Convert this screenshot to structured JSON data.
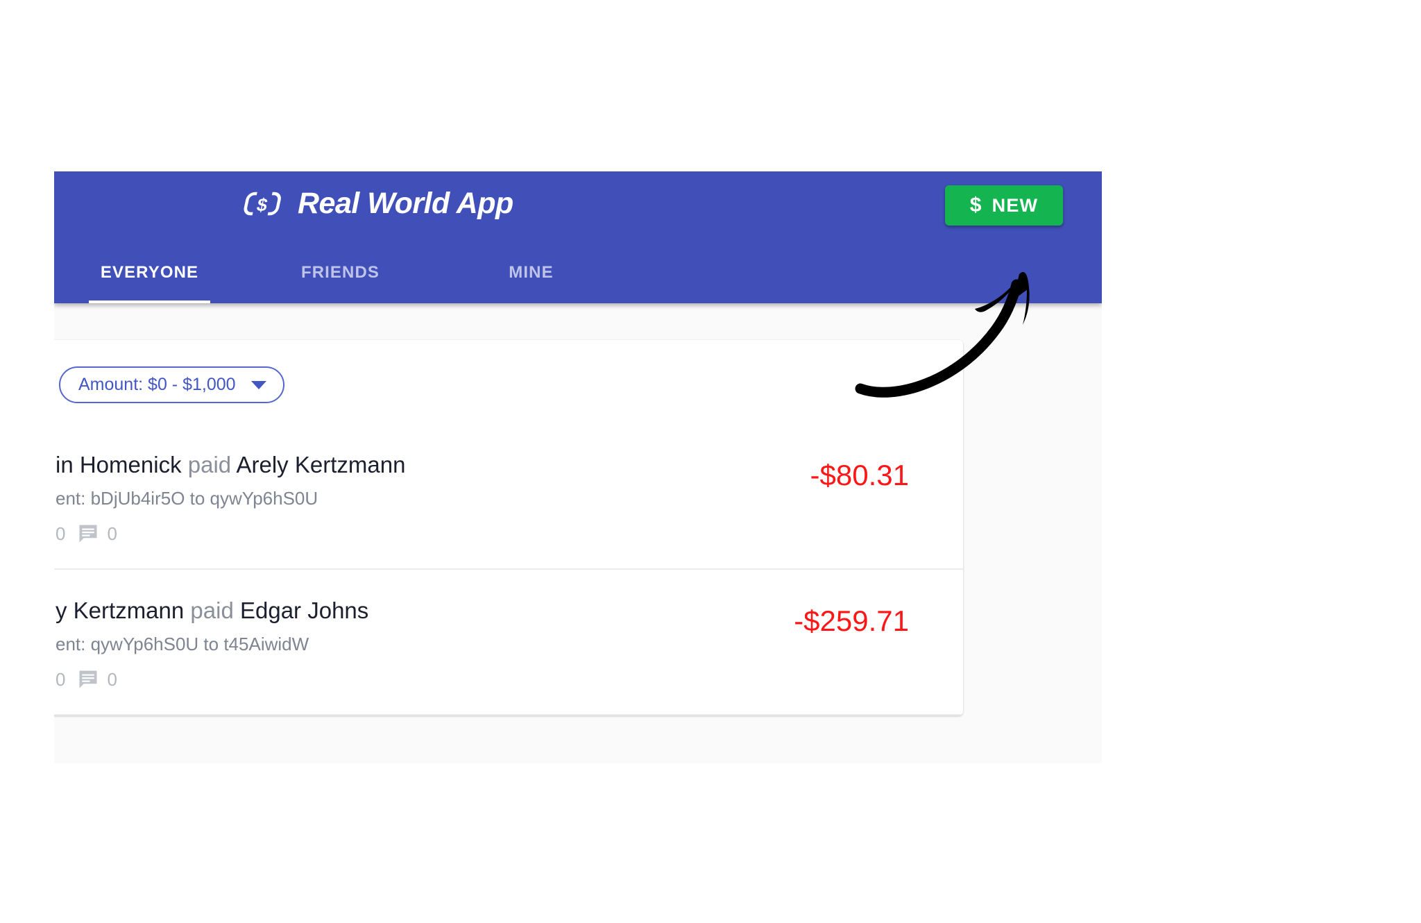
{
  "header": {
    "brand_title": "Real World App",
    "brand_icon": "chain-link-dollar-logo-icon",
    "new_button": {
      "dollar_glyph": "$",
      "label": "NEW",
      "color": "#14b451"
    },
    "background_color": "#4050b8"
  },
  "tabs": [
    {
      "label": "EVERYONE",
      "active": true
    },
    {
      "label": "FRIENDS",
      "active": false
    },
    {
      "label": "MINE",
      "active": false
    }
  ],
  "filters": {
    "amount_chip": {
      "label": "Amount: $0 - $1,000",
      "icon": "chevron-down-icon"
    }
  },
  "transactions": [
    {
      "actor": "in Homenick",
      "verb": "paid",
      "receiver": "Arely Kertzmann",
      "description": "ent: bDjUb4ir5O to qywYp6hS0U",
      "like_count": "0",
      "comment_count": "0",
      "amount": "-$80.31",
      "amount_color": "#ff1717"
    },
    {
      "actor": "y Kertzmann",
      "verb": "paid",
      "receiver": "Edgar Johns",
      "description": "ent: qywYp6hS0U to t45AiwidW",
      "like_count": "0",
      "comment_count": "0",
      "amount": "-$259.71",
      "amount_color": "#ff1717"
    }
  ],
  "annotation": {
    "arrow": "curved-arrow-pointing-to-new-button",
    "color": "#000000"
  }
}
